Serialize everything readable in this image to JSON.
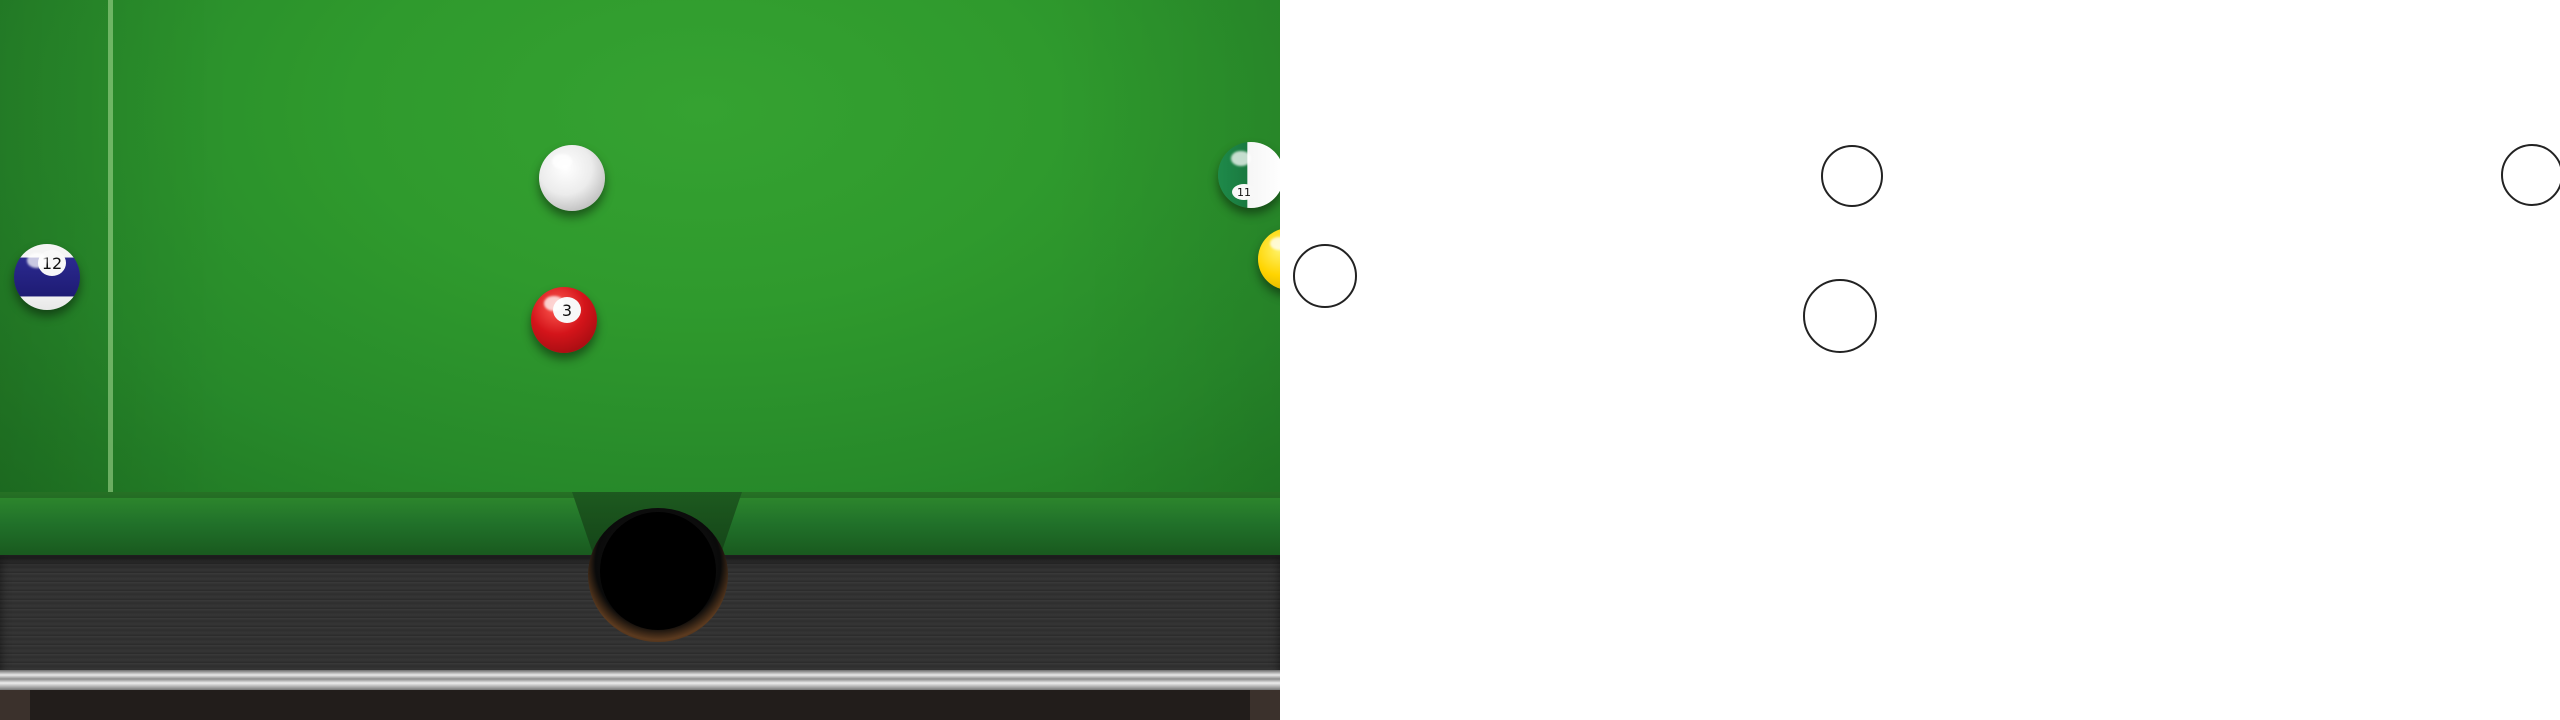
{
  "game": "pool",
  "colors": {
    "felt": "#2f9a2d",
    "rail": "#333333",
    "pocket": "#000000",
    "outline": "#222222",
    "panel_background": "#ffffff"
  },
  "balls": [
    {
      "id": "cue",
      "label": "",
      "color": "#f2f2f2",
      "style": "solid"
    },
    {
      "id": "3",
      "label": "3",
      "color": "#d4141a",
      "style": "solid"
    },
    {
      "id": "12",
      "label": "12",
      "color": "#2b2a8f",
      "style": "stripe"
    },
    {
      "id": "11",
      "label": "11",
      "color": "#1e8a4a",
      "style": "stripe",
      "partially_visible": true
    },
    {
      "id": "yellow",
      "label": "",
      "color": "#ffd400",
      "style": "solid",
      "partially_visible": true
    }
  ],
  "outlines": [
    {
      "target": "cue"
    },
    {
      "target": "3"
    },
    {
      "target": "12"
    },
    {
      "target": "11"
    }
  ]
}
